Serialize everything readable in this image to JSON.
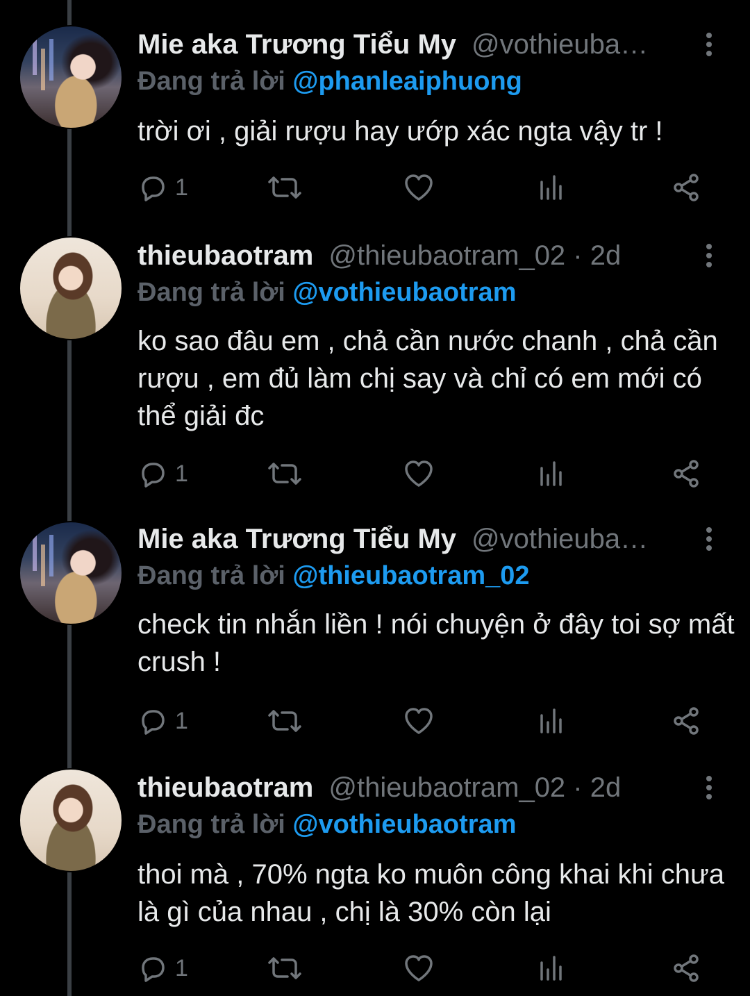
{
  "tweets": [
    {
      "name": "Mie aka Trương Tiểu My",
      "handle": "@vothieuba…",
      "reply_prefix": "Đang trả lời",
      "reply_to": "@phanleaiphuong",
      "text": "trời ơi , giải rượu hay ướp xác ngta vậy tr !",
      "reply_count": "1",
      "avatar": "mie"
    },
    {
      "name": "thieubaotram",
      "handle": "@thieubaotram_02 · 2d",
      "reply_prefix": "Đang trả lời",
      "reply_to": "@vothieubaotram",
      "text": "ko sao đâu em , chả cần nước chanh , chả cần rượu , em đủ làm chị say và chỉ có em mới có thể giải đc",
      "reply_count": "1",
      "avatar": "tram"
    },
    {
      "name": "Mie aka Trương Tiểu My",
      "handle": "@vothieuba…",
      "reply_prefix": "Đang trả lời",
      "reply_to": "@thieubaotram_02",
      "text": "check tin nhắn liền ! nói chuyện ở đây toi sợ mất crush !",
      "reply_count": "1",
      "avatar": "mie"
    },
    {
      "name": "thieubaotram",
      "handle": "@thieubaotram_02 · 2d",
      "reply_prefix": "Đang trả lời",
      "reply_to": "@vothieubaotram",
      "text": "thoi mà , 70% ngta ko muôn công khai khi chưa là gì của nhau , chị là 30% còn lại",
      "reply_count": "1",
      "avatar": "tram"
    }
  ],
  "icons": {
    "reply": "reply-bubble-icon",
    "retweet": "retweet-icon",
    "like": "heart-icon",
    "views": "views-chart-icon",
    "share": "share-icon",
    "more": "more-vertical-icon"
  },
  "colors": {
    "background": "#000000",
    "text": "#e7e9ea",
    "muted": "#71767b",
    "mention": "#1d9bf0"
  }
}
